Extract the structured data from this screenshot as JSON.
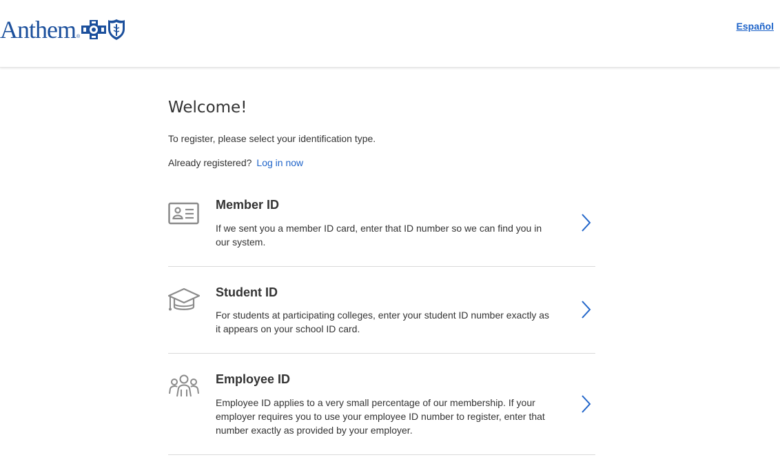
{
  "header": {
    "logo_text": "Anthem",
    "logo_reg": "®",
    "language_link": "Español"
  },
  "main": {
    "title": "Welcome!",
    "subtitle": "To register, please select your identification type.",
    "already_registered": "Already registered?",
    "login_link": "Log in now"
  },
  "options": [
    {
      "title": "Member ID",
      "description": "If we sent you a member ID card, enter that ID number so we can find you in our system.",
      "icon": "id-card-icon"
    },
    {
      "title": "Student ID",
      "description": "For students at participating colleges, enter your student ID number exactly as it appears on your school ID card.",
      "icon": "graduation-cap-icon"
    },
    {
      "title": "Employee ID",
      "description": "Employee ID applies to a very small percentage of our membership. If your employer requires you to use your employee ID number to register, enter that number exactly as provided by your employer.",
      "icon": "people-group-icon"
    }
  ],
  "colors": {
    "brand_blue": "#1b4f9c",
    "link_blue": "#1f64c9",
    "icon_gray": "#8a8a8a",
    "divider": "#d9d9d9"
  }
}
